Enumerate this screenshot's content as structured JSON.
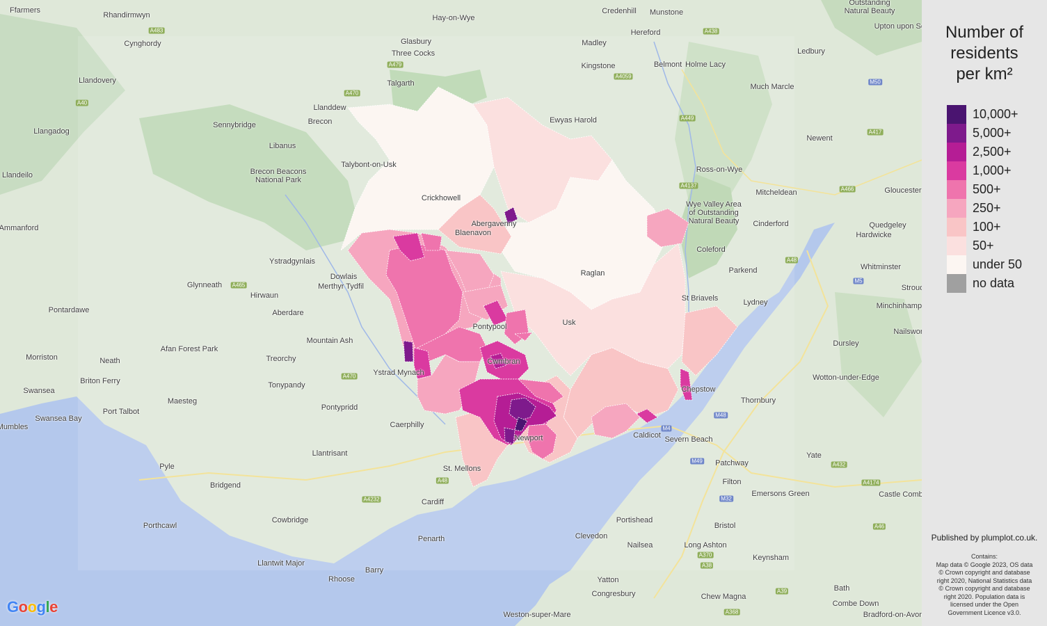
{
  "legend": {
    "title_lines": [
      "Number of",
      "residents",
      "per km²"
    ],
    "items": [
      {
        "label": "10,000+",
        "color": "#4a1470"
      },
      {
        "label": "5,000+",
        "color": "#7e1a8c"
      },
      {
        "label": "2,500+",
        "color": "#b51d95"
      },
      {
        "label": "1,000+",
        "color": "#da3aa0"
      },
      {
        "label": "500+",
        "color": "#ef74ad"
      },
      {
        "label": "250+",
        "color": "#f6a6bf"
      },
      {
        "label": "100+",
        "color": "#f9c5c6"
      },
      {
        "label": "50+",
        "color": "#fbe0df"
      },
      {
        "label": "under 50",
        "color": "#fcf6f2"
      },
      {
        "label": "no data",
        "color": "#a0a0a0"
      }
    ]
  },
  "published": "Published by plumplot.co.uk.",
  "credits": [
    "Contains:",
    "Map data © Google 2023, OS data",
    "© Crown copyright and database",
    "right 2020, National Statistics data",
    "© Crown copyright and database",
    "right 2020. Population data is",
    "licensed under the Open",
    "Government Licence v3.0."
  ],
  "google_logo": [
    "G",
    "o",
    "o",
    "g",
    "l",
    "e"
  ],
  "colors": {
    "land": "#dfe8d9",
    "sea": "#b4c8ec",
    "park": "#bcd8b4",
    "panel": "#e6e6e6"
  },
  "places": [
    "Ffarmers",
    "Rhandirmwyn",
    "Cynghordy",
    "Llandovery",
    "Llangadog",
    "Llandeilo",
    "Ammanford",
    "Sennybridge",
    "Libanus",
    "Brecon",
    "Llanddew",
    "Talgarth",
    "Glasbury",
    "Three Cocks",
    "Hay-on-Wye",
    "Talybont-on-Usk",
    "Brecon Beacons National Park",
    "Ystradgynlais",
    "Glynneath",
    "Hirwaun",
    "Dowlais",
    "Merthyr Tydfil",
    "Aberdare",
    "Pontardawe",
    "Afan Forest Park",
    "Mountain Ash",
    "Treorchy",
    "Morriston",
    "Neath",
    "Swansea",
    "Briton Ferry",
    "Swansea Bay",
    "Port Talbot",
    "Mumbles",
    "Maesteg",
    "Tonypandy",
    "Pontypridd",
    "Caerphilly",
    "Ystrad Mynach",
    "Llantrisant",
    "Pyle",
    "Bridgend",
    "Porthcawl",
    "Cowbridge",
    "Cardiff",
    "St. Mellons",
    "Penarth",
    "Barry",
    "Llantwit Major",
    "Rhoose",
    "Credenhill",
    "Munstone",
    "Hereford",
    "Madley",
    "Belmont",
    "Kingstone",
    "Holme Lacy",
    "Ewyas Harold",
    "Much Marcle",
    "Ledbury",
    "Ross-on-Wye",
    "Newent",
    "Mitcheldean",
    "Gloucester",
    "Wye Valley Area of Outstanding Natural Beauty",
    "Coleford",
    "Cinderford",
    "Quedgeley",
    "Hardwicke",
    "Parkend",
    "Whitminster",
    "St Briavels",
    "Lydney",
    "Stroud",
    "Minchinhampton",
    "Nailsworth",
    "Dursley",
    "Wotton-under-Edge",
    "Thornbury",
    "Severn Beach",
    "Patchway",
    "Yate",
    "Filton",
    "Emersons Green",
    "Portishead",
    "Bristol",
    "Clevedon",
    "Nailsea",
    "Long Ashton",
    "Keynsham",
    "Yatton",
    "Congresbury",
    "Chew Magna",
    "Weston-super-Mare",
    "Bath",
    "Combe Down",
    "Bradford-on-Avon",
    "Castle Combe",
    "Upton upon Severn",
    "Outstanding Natural Beauty",
    "Abergavenny",
    "Raglan",
    "Crickhowell",
    "Usk",
    "Chepstow",
    "Caldicot",
    "Newport",
    "Pontypool",
    "Cwmbran",
    "Blaenavon"
  ],
  "roads": [
    "A483",
    "A470",
    "A40",
    "A479",
    "A465",
    "A4059",
    "A4137",
    "A449",
    "A438",
    "A417",
    "A48",
    "M50",
    "M5",
    "M4",
    "M48",
    "M49",
    "M32",
    "A470",
    "A48",
    "A4232",
    "A370",
    "A38",
    "A39",
    "A368",
    "A432",
    "A46",
    "A4174",
    "A466"
  ]
}
